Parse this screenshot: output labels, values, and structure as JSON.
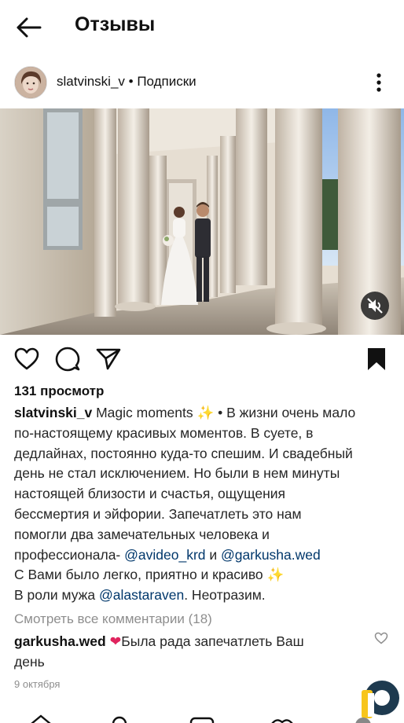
{
  "header": {
    "title": "Отзывы"
  },
  "post": {
    "username": "slatvinski_v",
    "follow_label": "Подписки",
    "separator": " • ",
    "views": "131 просмотр",
    "caption": {
      "username": "slatvinski_v",
      "line1_text": " Magic moments ",
      "line1_rest": " • В жизни очень мало",
      "lines": [
        "по-настоящему красивых моментов. В суете, в",
        "дедлайнах, постоянно куда-то спешим. И свадебный",
        "день не стал исключением. Но были в нем минуты",
        "настоящей близости и счастья, ощущения",
        "бессмертия и эйфории. Запечатлеть это нам",
        "помогли два замечательных человека и"
      ],
      "pro_text": "профессионала- ",
      "mention1": "@avideo_krd",
      "and_text": " и ",
      "mention2": "@garkusha.wed",
      "line_thanks": "С Вами было легко, приятно и красиво ",
      "husband_prefix": "В роли мужа ",
      "mention3": "@alastaraven",
      "husband_suffix": ". Неотразим."
    },
    "view_comments": "Смотреть все комментарии (18)",
    "comment": {
      "username": "garkusha.wed",
      "text": "Была рада запечатлеть Ваш",
      "text2": "день"
    },
    "date": "9 октября"
  },
  "icons": {
    "back": "arrow-left-icon",
    "more": "more-vertical-icon",
    "mute": "volume-off-icon",
    "like": "heart-icon",
    "comment": "comment-icon",
    "share": "paper-plane-icon",
    "save": "bookmark-icon",
    "sparkles": "sparkles-icon",
    "red_heart": "red-heart-icon"
  },
  "colors": {
    "text": "#262626",
    "link": "#00376b",
    "muted": "#8e8e8e",
    "heart": "#e0245e",
    "sparkle": "#f5c518"
  }
}
